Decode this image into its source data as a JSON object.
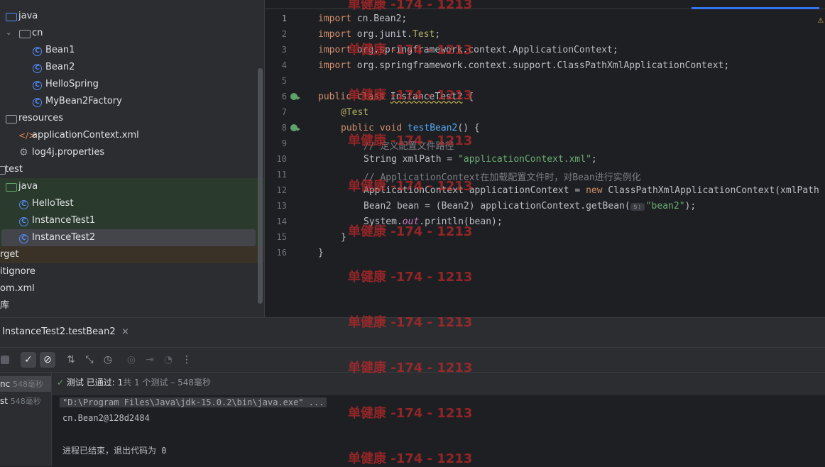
{
  "project_tree": {
    "items": [
      {
        "label": "java",
        "icon": "folder-icon"
      },
      {
        "label": "cn",
        "icon": "package-icon"
      },
      {
        "label": "Bean1",
        "icon": "class-icon"
      },
      {
        "label": "Bean2",
        "icon": "class-icon"
      },
      {
        "label": "HelloSpring",
        "icon": "class-icon"
      },
      {
        "label": "MyBean2Factory",
        "icon": "class-icon"
      },
      {
        "label": "resources",
        "icon": "resources-folder-icon"
      },
      {
        "label": "applicationContext.xml",
        "icon": "xml-file-icon"
      },
      {
        "label": "log4j.properties",
        "icon": "properties-file-icon"
      },
      {
        "label": "test",
        "icon": "folder-icon"
      },
      {
        "label": "java",
        "icon": "test-folder-icon"
      },
      {
        "label": "HelloTest",
        "icon": "class-icon"
      },
      {
        "label": "InstanceTest1",
        "icon": "class-icon"
      },
      {
        "label": "InstanceTest2",
        "icon": "class-icon"
      },
      {
        "label": "rget",
        "icon": "folder-icon"
      },
      {
        "label": "itignore",
        "icon": "file-icon"
      },
      {
        "label": "om.xml",
        "icon": "file-icon"
      },
      {
        "label": "库",
        "icon": "file-icon"
      }
    ]
  },
  "editor": {
    "line_numbers": [
      "1",
      "2",
      "3",
      "4",
      "5",
      "6",
      "7",
      "8",
      "9",
      "10",
      "11",
      "12",
      "13",
      "14",
      "15",
      "16"
    ],
    "code": {
      "l1_kw": "import ",
      "l1_rest": "cn.Bean2;",
      "l2_kw": "import ",
      "l2_a": "org.junit.",
      "l2_b": "Test",
      "l2_c": ";",
      "l3_kw": "import ",
      "l3_rest": "org.springframework.context.ApplicationContext;",
      "l4_kw": "import ",
      "l4_rest": "org.springframework.context.support.ClassPathXmlApplicationContext;",
      "l6_kw": "public class ",
      "l6_cls": "InstanceTest2",
      "l6_rest": " {",
      "l7_ann": "@Test",
      "l8_kw": "public void ",
      "l8_fn": "testBean2",
      "l8_rest": "() {",
      "l9_cmt": "// 定义配置文件路径",
      "l10_a": "String xmlPath = ",
      "l10_str": "\"applicationContext.xml\"",
      "l10_c": ";",
      "l11_cmt": "// ApplicationContext在加载配置文件时，对Bean进行实例化",
      "l12_a": "ApplicationContext applicationContext = ",
      "l12_kw": "new ",
      "l12_b": "ClassPathXmlApplicationContext(xmlPath",
      "l13_a": "Bean2 bean = (Bean2) applicationContext.getBean(",
      "l13_hint": "s:",
      "l13_str": "\"bean2\"",
      "l13_c": ");",
      "l14_a": "System.",
      "l14_fld": "out",
      "l14_b": ".println(bean);",
      "l15": "}",
      "l16": "}"
    }
  },
  "run_panel": {
    "tab_title": "InstanceTest2.testBean2",
    "close_glyph": "×",
    "toolbar_icons": [
      "stop-icon",
      "show-passed-icon",
      "show-ignored-icon",
      "sort-icon",
      "collapse-icon",
      "history-icon",
      "screenshot-icon",
      "export-icon",
      "import-icon",
      "more-icon"
    ],
    "tests": [
      {
        "name": "nc",
        "time": "548毫秒"
      },
      {
        "name": "st",
        "time": "548毫秒"
      }
    ],
    "status": {
      "check": "✓",
      "passed_label": "测试 已通过:",
      "passed_count": "1",
      "detail": "共 1 个测试 – 548毫秒"
    },
    "console": [
      "\"D:\\Program Files\\Java\\jdk-15.0.2\\bin\\java.exe\" ...",
      "cn.Bean2@128d2484",
      "",
      "进程已结束，退出代码为 0"
    ]
  },
  "watermark": "单健康 -174 - 1213",
  "colors": {
    "background": "#1e1f22",
    "panel": "#2b2d30",
    "accent": "#3574f0",
    "keyword": "#cf8e6d",
    "string": "#6aab73",
    "watermark": "#c0282a"
  }
}
